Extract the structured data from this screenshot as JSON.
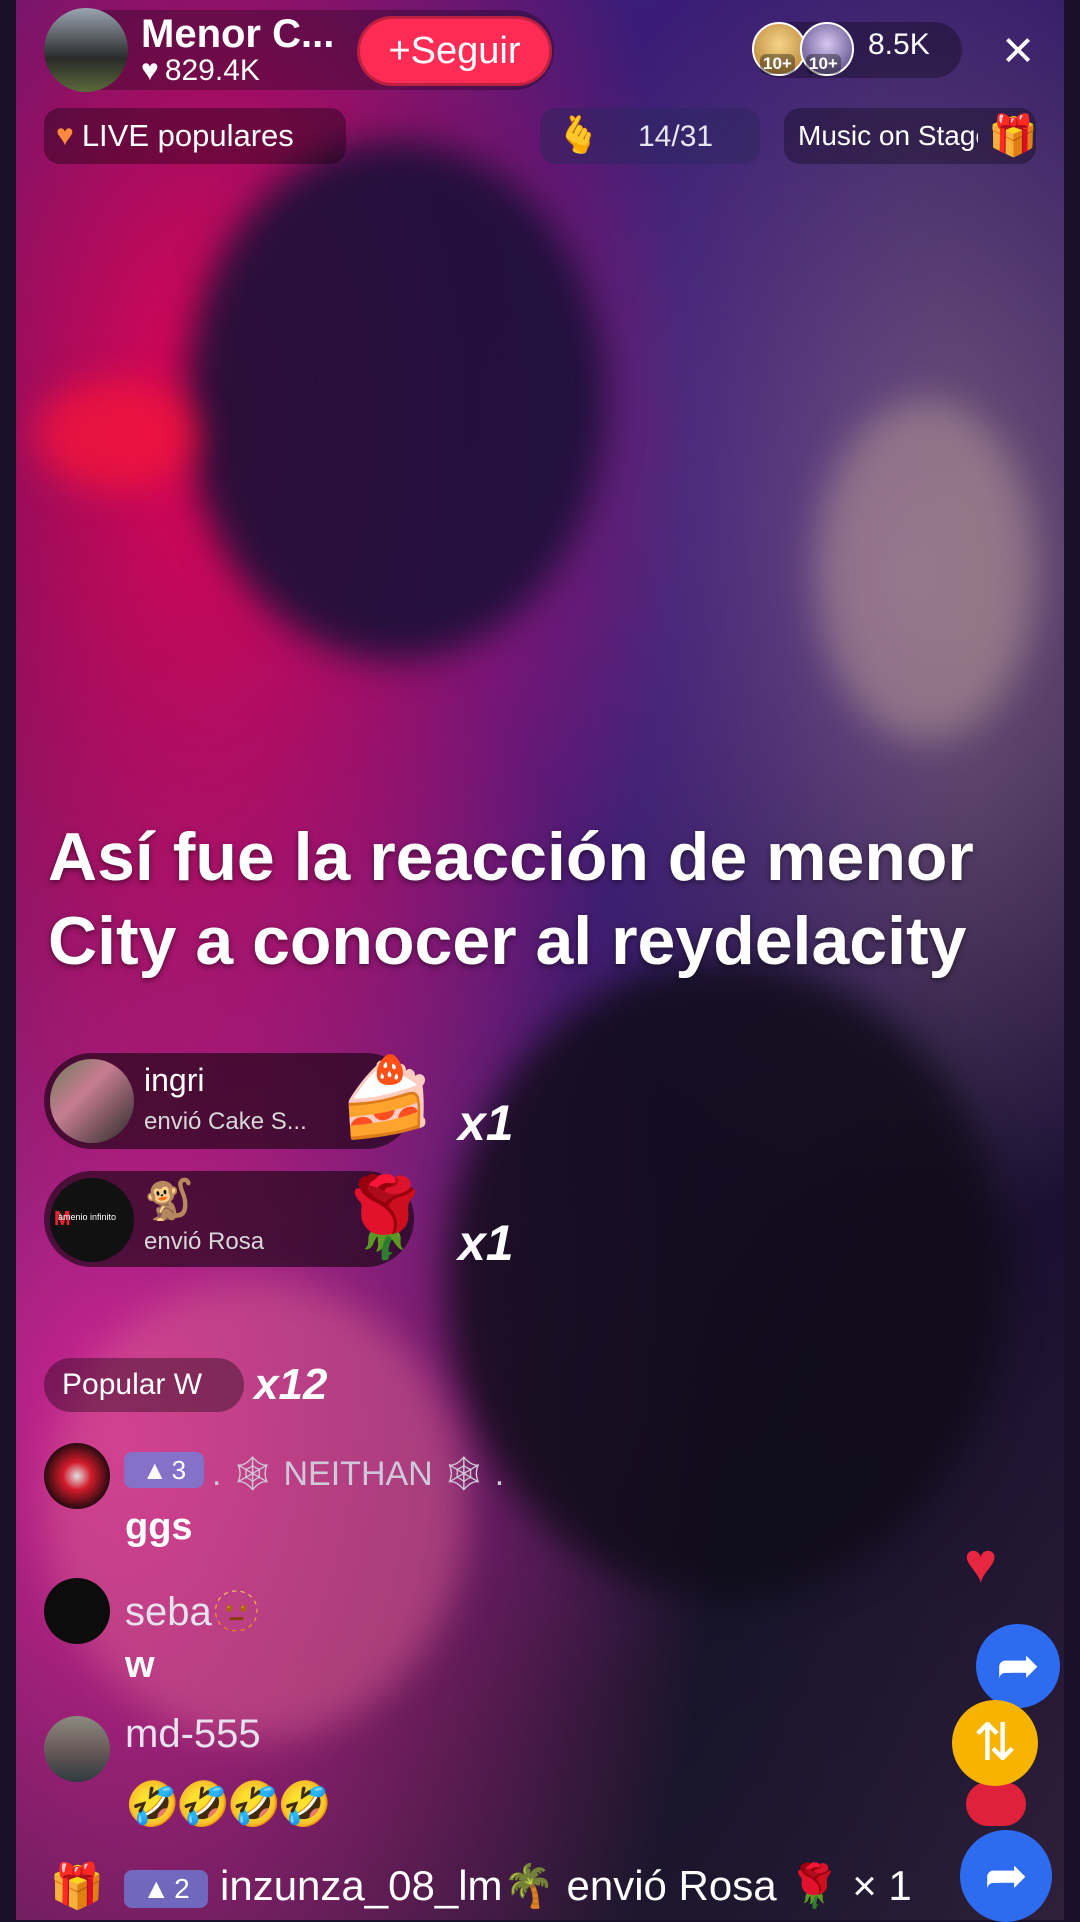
{
  "host": {
    "name": "Menor C...",
    "likes": "829.4K",
    "follow_label": "Seguir"
  },
  "viewers": {
    "badge1": "10+",
    "badge2": "10+",
    "count": "8.5K"
  },
  "close_icon": "×",
  "live_label": "LIVE populares",
  "rank_label": "14/31",
  "music_label": "Music on Stage",
  "caption": "Así fue la reacción de menor City a conocer al reydelacity",
  "gifts": [
    {
      "user": "ingri",
      "action": "envió Cake S...",
      "count": "x1",
      "icon": "🍰"
    },
    {
      "user": "🐒",
      "action": "envió Rosa",
      "count": "x1",
      "icon": "🌹",
      "avatar_text": "ámenio infinito"
    }
  ],
  "popular": {
    "label": "Popular W",
    "count": "x12"
  },
  "comments": [
    {
      "user": ". 🕸 NEITHAN 🕸 .",
      "level": "3",
      "message": "ggs"
    },
    {
      "user": "seba🫥",
      "message": "w"
    },
    {
      "user": "md-555",
      "message": "🤣🤣🤣🤣"
    }
  ],
  "bottom": {
    "level": "2",
    "text": "inzunza_08_lm🌴 envió Rosa 🌹 × 1"
  },
  "colors": {
    "follow": "#fe2c55",
    "share": "#2d6bf0",
    "repost": "#f6b400",
    "level_badge": "#6e82dc"
  },
  "icons": {
    "heart": "heart-icon",
    "gift": "gift-icon",
    "share": "share-icon",
    "repost": "repost-icon",
    "close": "close-icon",
    "rank": "hand-heart-icon",
    "music": "music-stage-icon"
  }
}
